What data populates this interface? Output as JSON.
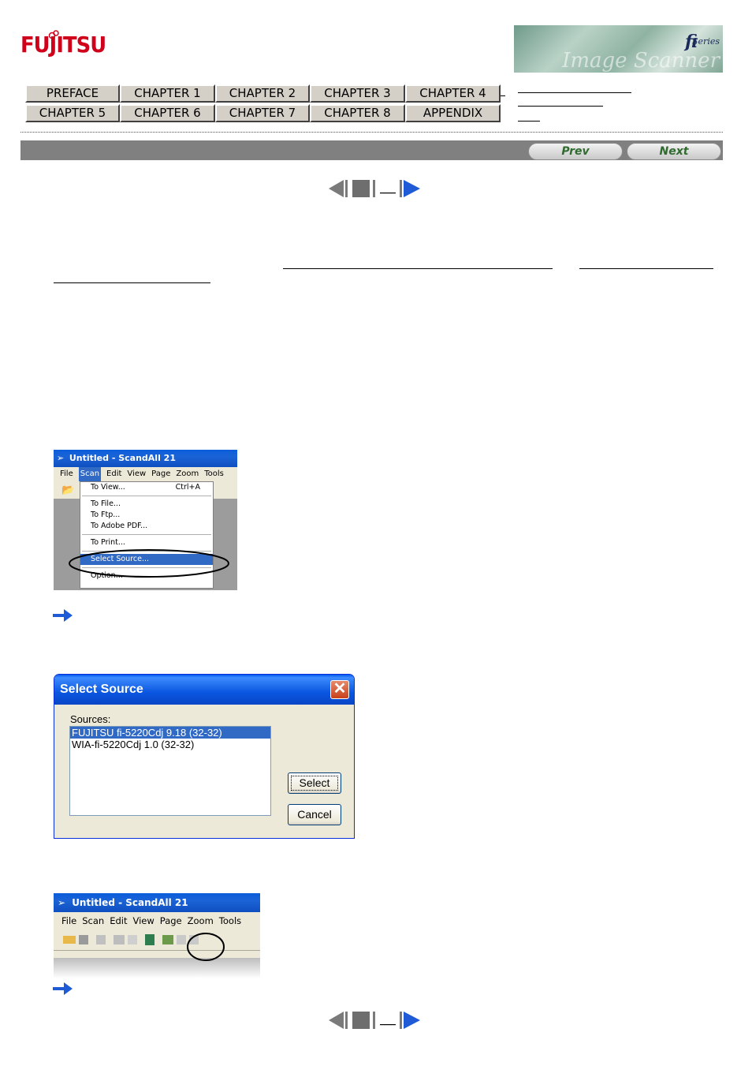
{
  "header": {
    "logo_text": "FUJITSU",
    "banner_brand": "fi",
    "banner_series": "Series",
    "banner_ghost": "Image Scanner"
  },
  "chapter_nav": {
    "row1": [
      "PREFACE",
      "CHAPTER 1",
      "CHAPTER 2",
      "CHAPTER 3",
      "CHAPTER 4"
    ],
    "row2": [
      "CHAPTER 5",
      "CHAPTER 6",
      "CHAPTER 7",
      "CHAPTER 8",
      "APPENDIX"
    ]
  },
  "page_nav": {
    "prev_label": "Prev",
    "next_label": "Next"
  },
  "scandall_menu": {
    "title": "Untitled - ScandAll 21",
    "menus": [
      "File",
      "Scan",
      "Edit",
      "View",
      "Page",
      "Zoom",
      "Tools"
    ],
    "scan_items": [
      {
        "label": "To View...",
        "shortcut": "Ctrl+A"
      },
      {
        "label": "To File..."
      },
      {
        "label": "To Ftp..."
      },
      {
        "label": "To Adobe PDF..."
      },
      {
        "label": "To Print..."
      },
      {
        "label": "Select Source..."
      },
      {
        "label": "Option..."
      }
    ]
  },
  "select_source_dialog": {
    "title": "Select Source",
    "close_glyph": "✕",
    "sources_label": "Sources:",
    "sources": [
      "FUJITSU fi-5220Cdj 9.18 (32-32)",
      "WIA-fi-5220Cdj 1.0 (32-32)"
    ],
    "selected_index": 0,
    "select_button": "Select",
    "cancel_button": "Cancel"
  },
  "scandall_toolbar": {
    "title": "Untitled - ScandAll 21",
    "menus": [
      "File",
      "Scan",
      "Edit",
      "View",
      "Page",
      "Zoom",
      "Tools"
    ]
  },
  "colors": {
    "brand_red": "#d0021b",
    "xp_blue": "#0a5ddb",
    "selection_blue": "#316ac5",
    "arrow_blue": "#1f5bd6"
  }
}
